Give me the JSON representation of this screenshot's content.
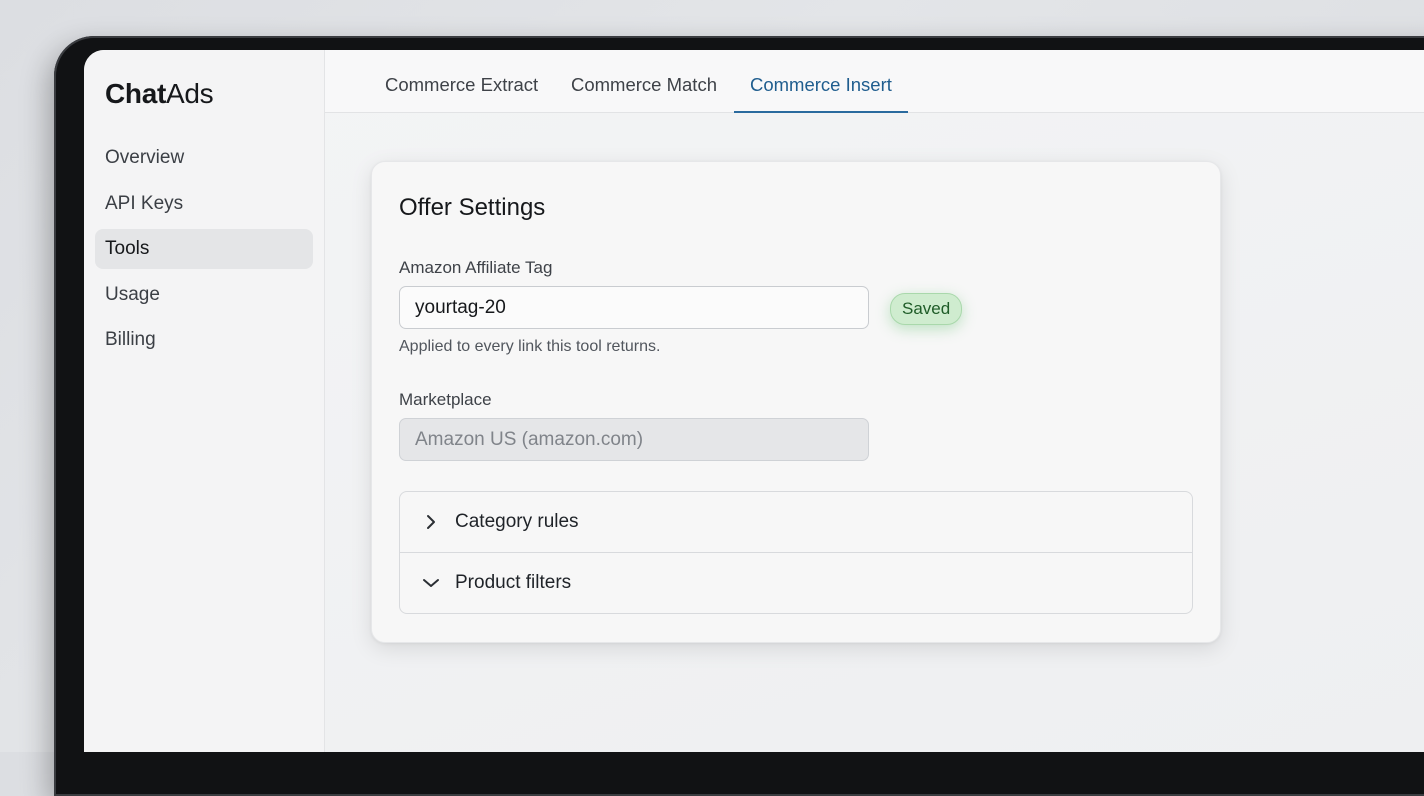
{
  "app": {
    "brand_bold": "Chat",
    "brand_light": "Ads"
  },
  "sidebar": {
    "items": [
      {
        "label": "Overview",
        "active": false
      },
      {
        "label": "API Keys",
        "active": false
      },
      {
        "label": "Tools",
        "active": true
      },
      {
        "label": "Usage",
        "active": false
      },
      {
        "label": "Billing",
        "active": false
      }
    ]
  },
  "tabs": [
    {
      "label": "Commerce Extract",
      "active": false
    },
    {
      "label": "Commerce Match",
      "active": false
    },
    {
      "label": "Commerce Insert",
      "active": true
    }
  ],
  "card": {
    "title": "Offer Settings",
    "affiliate": {
      "label": "Amazon Affiliate Tag",
      "value": "yourtag-20",
      "help": "Applied to every link this tool returns.",
      "status": "Saved"
    },
    "marketplace": {
      "label": "Marketplace",
      "value": "Amazon US (amazon.com)"
    },
    "accordion": [
      {
        "label": "Category rules",
        "icon": "chevron-right-icon",
        "expanded": false
      },
      {
        "label": "Product filters",
        "icon": "chevron-down-icon",
        "expanded": true
      }
    ]
  },
  "colors": {
    "accent": "#1f5d8e",
    "saved_bg": "#cfeccf",
    "saved_text": "#1f5c28"
  }
}
